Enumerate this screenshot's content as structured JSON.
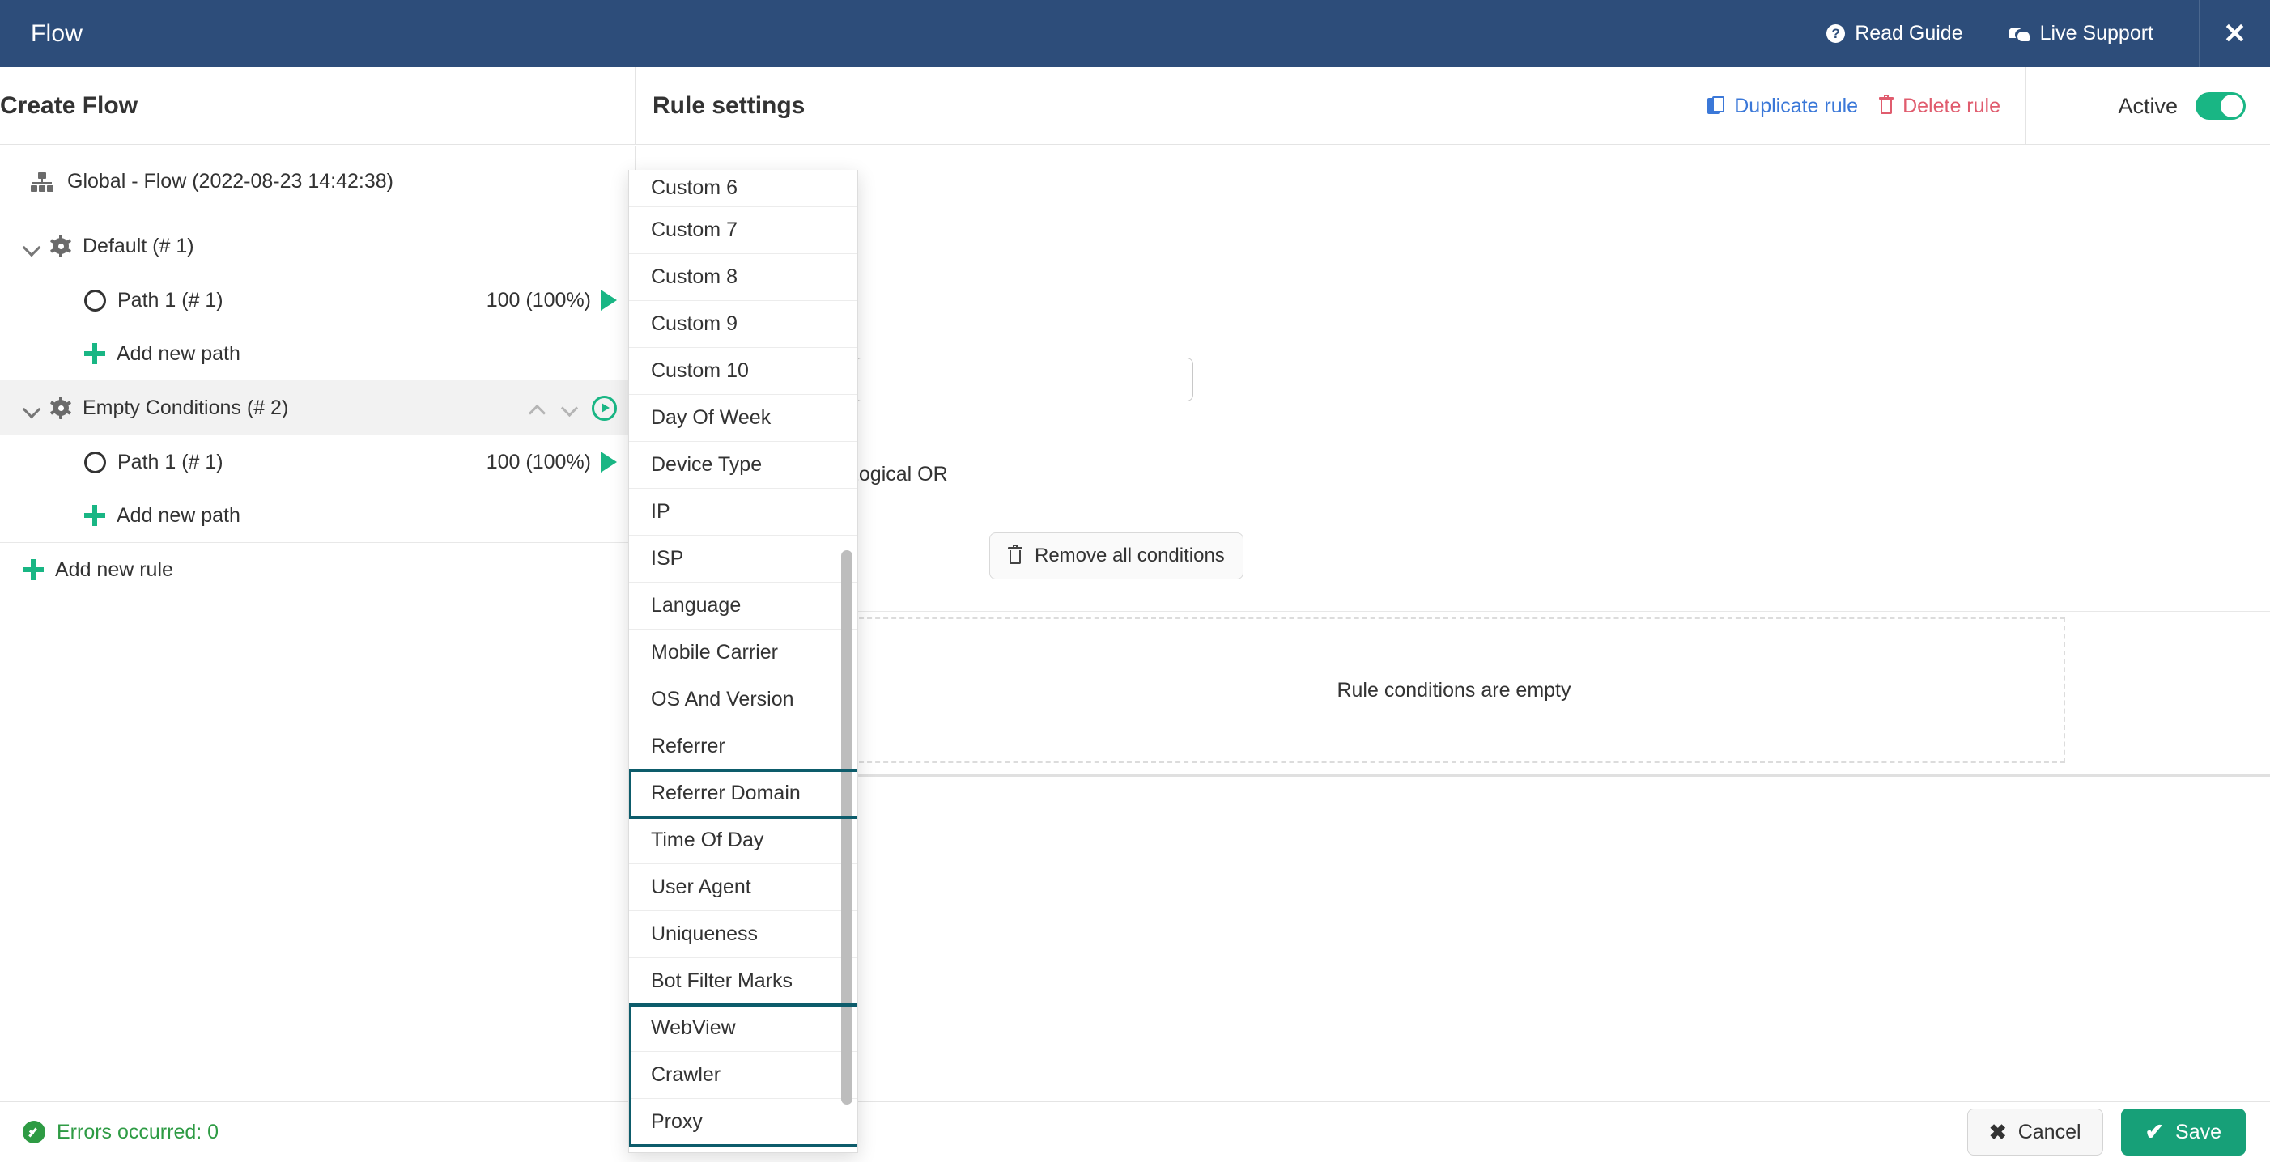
{
  "topbar": {
    "title": "Flow",
    "read_guide": "Read Guide",
    "live_support": "Live Support",
    "help_glyph": "?",
    "close_glyph": "✕"
  },
  "subbar": {
    "left_title": "Create Flow",
    "rule_settings_title": "Rule settings",
    "duplicate_rule": "Duplicate rule",
    "delete_rule": "Delete rule",
    "active_label": "Active",
    "active_on": true
  },
  "tree": {
    "root_label": "Global - Flow (2022-08-23 14:42:38)",
    "rules": [
      {
        "label": "Default (# 1)",
        "selected": false,
        "paths": [
          {
            "label": "Path 1 (# 1)",
            "count": "100 (100%)"
          }
        ],
        "add_path_label": "Add new path"
      },
      {
        "label": "Empty Conditions (# 2)",
        "selected": true,
        "paths": [
          {
            "label": "Path 1 (# 1)",
            "count": "100 (100%)"
          }
        ],
        "add_path_label": "Add new path"
      }
    ],
    "add_rule_label": "Add new rule"
  },
  "rule_settings": {
    "name_value": "",
    "name_placeholder": "",
    "logical_or_label": "Logical OR",
    "remove_all_label": "Remove all conditions",
    "empty_conditions_text": "Rule conditions are empty"
  },
  "dropdown": {
    "items": [
      {
        "label": "Custom 6",
        "highlight": "none",
        "partial": true
      },
      {
        "label": "Custom 7",
        "highlight": "none"
      },
      {
        "label": "Custom 8",
        "highlight": "none"
      },
      {
        "label": "Custom 9",
        "highlight": "none"
      },
      {
        "label": "Custom 10",
        "highlight": "none"
      },
      {
        "label": "Day Of Week",
        "highlight": "none"
      },
      {
        "label": "Device Type",
        "highlight": "none"
      },
      {
        "label": "IP",
        "highlight": "none"
      },
      {
        "label": "ISP",
        "highlight": "none"
      },
      {
        "label": "Language",
        "highlight": "none"
      },
      {
        "label": "Mobile Carrier",
        "highlight": "none"
      },
      {
        "label": "OS And Version",
        "highlight": "none"
      },
      {
        "label": "Referrer",
        "highlight": "none"
      },
      {
        "label": "Referrer Domain",
        "highlight": "single"
      },
      {
        "label": "Time Of Day",
        "highlight": "none"
      },
      {
        "label": "User Agent",
        "highlight": "none"
      },
      {
        "label": "Uniqueness",
        "highlight": "none"
      },
      {
        "label": "Bot Filter Marks",
        "highlight": "none"
      },
      {
        "label": "WebView",
        "highlight": "group-start"
      },
      {
        "label": "Crawler",
        "highlight": "group-mid"
      },
      {
        "label": "Proxy",
        "highlight": "group-end"
      }
    ],
    "highlight_color": "#0d5c6b",
    "scrollbar_visible": true
  },
  "bottombar": {
    "errors_label": "Errors occurred: 0",
    "cancel_label": "Cancel",
    "save_label": "Save",
    "cancel_glyph": "✖",
    "save_glyph": "✔"
  },
  "colors": {
    "header_blue": "#2d4d7a",
    "accent_green": "#19b684",
    "link_blue": "#3b78d8",
    "danger_red": "#e05c6e",
    "success_green": "#2e9b44",
    "highlight_teal": "#0d5c6b"
  }
}
